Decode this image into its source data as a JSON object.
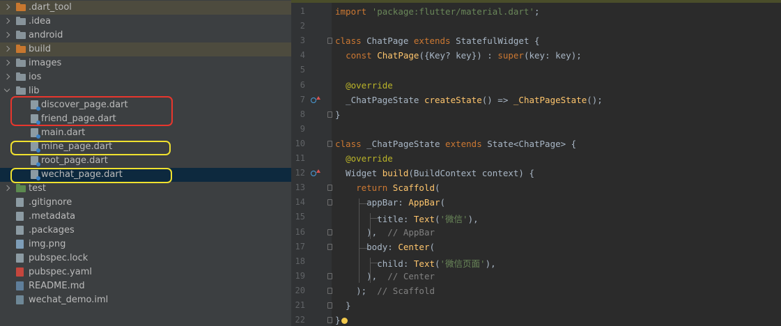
{
  "project_tree": {
    "items": [
      {
        "label": ".dart_tool",
        "icon": "folder-orange-icon"
      },
      {
        "label": ".idea",
        "icon": "folder-icon"
      },
      {
        "label": "android",
        "icon": "folder-icon"
      },
      {
        "label": "build",
        "icon": "folder-orange-icon"
      },
      {
        "label": "images",
        "icon": "folder-icon"
      },
      {
        "label": "ios",
        "icon": "folder-icon"
      },
      {
        "label": "lib",
        "icon": "folder-icon"
      },
      {
        "label": "discover_page.dart",
        "icon": "dart-file-icon"
      },
      {
        "label": "friend_page.dart",
        "icon": "dart-file-icon"
      },
      {
        "label": "main.dart",
        "icon": "dart-file-icon"
      },
      {
        "label": "mine_page.dart",
        "icon": "dart-file-icon"
      },
      {
        "label": "root_page.dart",
        "icon": "dart-file-icon"
      },
      {
        "label": "wechat_page.dart",
        "icon": "dart-file-icon"
      },
      {
        "label": "test",
        "icon": "test-folder-icon"
      },
      {
        "label": ".gitignore",
        "icon": "file-icon"
      },
      {
        "label": ".metadata",
        "icon": "file-icon"
      },
      {
        "label": ".packages",
        "icon": "file-icon"
      },
      {
        "label": "img.png",
        "icon": "image-file-icon"
      },
      {
        "label": "pubspec.lock",
        "icon": "file-icon"
      },
      {
        "label": "pubspec.yaml",
        "icon": "yaml-file-icon"
      },
      {
        "label": "README.md",
        "icon": "markdown-file-icon"
      },
      {
        "label": "wechat_demo.iml",
        "icon": "iml-file-icon"
      }
    ],
    "selected": "wechat_page.dart",
    "highlight_colors": {
      "red": "#e8362d",
      "yellow": "#f0e12f"
    }
  },
  "editor": {
    "line_numbers": [
      "1",
      "2",
      "3",
      "4",
      "5",
      "6",
      "7",
      "8",
      "9",
      "10",
      "11",
      "12",
      "13",
      "14",
      "15",
      "16",
      "17",
      "18",
      "19",
      "20",
      "21",
      "22"
    ],
    "lines": [
      [
        [
          "kw",
          "import "
        ],
        [
          "str",
          "'package:flutter/material.dart'"
        ],
        [
          "p",
          ";"
        ]
      ],
      [],
      [
        [
          "kw",
          "class "
        ],
        [
          "p",
          "ChatPage "
        ],
        [
          "kw",
          "extends "
        ],
        [
          "p",
          "StatefulWidget {"
        ]
      ],
      [
        [
          "p",
          "  "
        ],
        [
          "kw",
          "const "
        ],
        [
          "fn",
          "ChatPage"
        ],
        [
          "p",
          "({Key? key}) : "
        ],
        [
          "kw",
          "super"
        ],
        [
          "p",
          "(key: key);"
        ]
      ],
      [],
      [
        [
          "p",
          "  "
        ],
        [
          "ann",
          "@override"
        ]
      ],
      [
        [
          "p",
          "  _ChatPageState "
        ],
        [
          "fn",
          "createState"
        ],
        [
          "p",
          "() => "
        ],
        [
          "fn",
          "_ChatPageState"
        ],
        [
          "p",
          "();"
        ]
      ],
      [
        [
          "p",
          "}"
        ]
      ],
      [],
      [
        [
          "kw",
          "class "
        ],
        [
          "p",
          "_ChatPageState "
        ],
        [
          "kw",
          "extends "
        ],
        [
          "p",
          "State<ChatPage> {"
        ]
      ],
      [
        [
          "p",
          "  "
        ],
        [
          "ann",
          "@override"
        ]
      ],
      [
        [
          "p",
          "  Widget "
        ],
        [
          "fn",
          "build"
        ],
        [
          "p",
          "(BuildContext context) {"
        ]
      ],
      [
        [
          "p",
          "    "
        ],
        [
          "kw",
          "return "
        ],
        [
          "fn",
          "Scaffold"
        ],
        [
          "p",
          "("
        ]
      ],
      [
        [
          "p",
          "      appBar: "
        ],
        [
          "fn",
          "AppBar"
        ],
        [
          "p",
          "("
        ]
      ],
      [
        [
          "p",
          "        title: "
        ],
        [
          "fn",
          "Text"
        ],
        [
          "p",
          "("
        ],
        [
          "str",
          "'微信'"
        ],
        [
          "p",
          "),"
        ]
      ],
      [
        [
          "p",
          "      ),  "
        ],
        [
          "cm",
          "// AppBar"
        ]
      ],
      [
        [
          "p",
          "      body: "
        ],
        [
          "fn",
          "Center"
        ],
        [
          "p",
          "("
        ]
      ],
      [
        [
          "p",
          "        child: "
        ],
        [
          "fn",
          "Text"
        ],
        [
          "p",
          "("
        ],
        [
          "str",
          "'微信页面'"
        ],
        [
          "p",
          "),"
        ]
      ],
      [
        [
          "p",
          "      ),  "
        ],
        [
          "cm",
          "// Center"
        ]
      ],
      [
        [
          "p",
          "    );  "
        ],
        [
          "cm",
          "// Scaffold"
        ]
      ],
      [
        [
          "p",
          "  }"
        ]
      ],
      [
        [
          "p",
          "}"
        ]
      ]
    ],
    "colors": {
      "keyword": "#cc7832",
      "string": "#6a8759",
      "function": "#ffc66d",
      "annotation": "#bbb529",
      "comment": "#808080",
      "plain": "#a9b7c6"
    }
  }
}
